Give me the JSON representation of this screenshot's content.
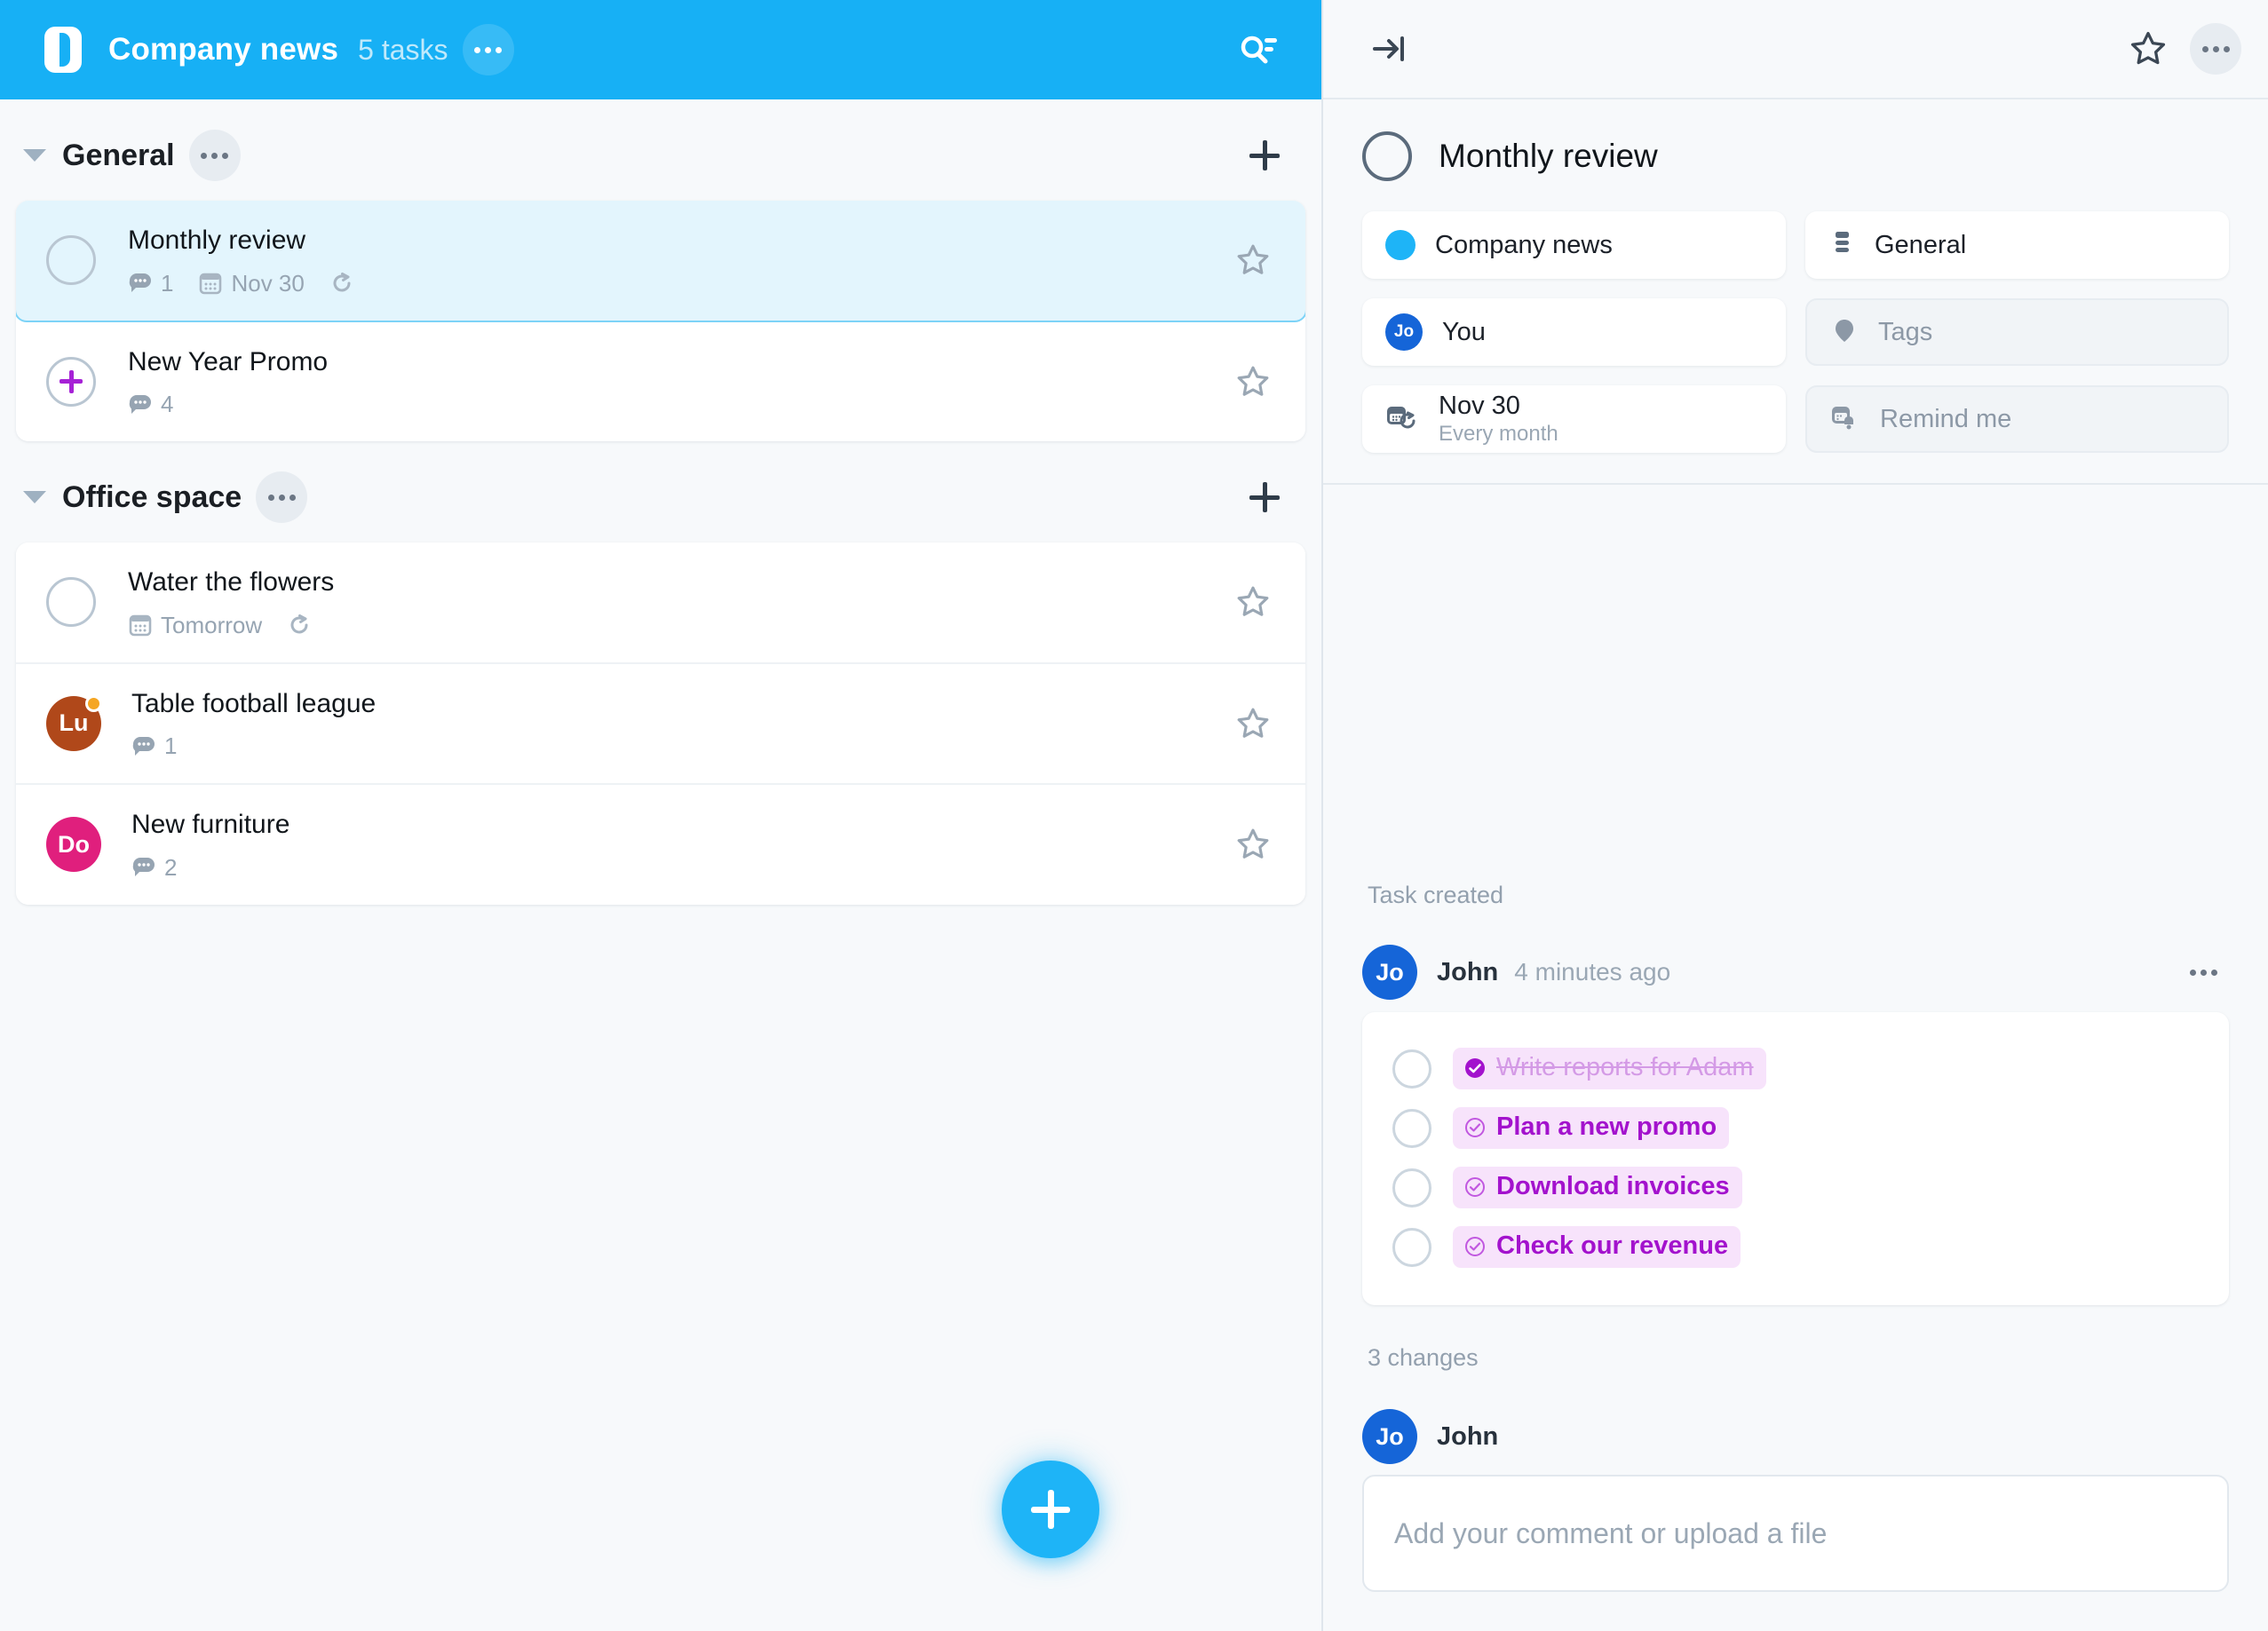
{
  "topbar": {
    "logo_icon": "app-logo-icon",
    "title": "Company news",
    "task_count": "5 tasks",
    "menu_icon": "more-options-icon",
    "search_icon": "search-filter-icon",
    "background_color": "#17b0f5"
  },
  "groups": [
    {
      "name": "General",
      "menu_icon": "more-options-icon",
      "add_icon": "plus-icon",
      "tasks": [
        {
          "title": "Monthly review",
          "selected": true,
          "marker": "checkbox",
          "comment_count": "1",
          "due": "Nov 30",
          "recurring": true,
          "star_icon": "star-outline-icon"
        },
        {
          "title": "New Year Promo",
          "selected": false,
          "marker": "add-subtask",
          "comment_count": "4",
          "due": "",
          "recurring": false,
          "star_icon": "star-outline-icon"
        }
      ]
    },
    {
      "name": "Office space",
      "menu_icon": "more-options-icon",
      "add_icon": "plus-icon",
      "tasks": [
        {
          "title": "Water the flowers",
          "selected": false,
          "marker": "checkbox",
          "comment_count": "",
          "due": "Tomorrow",
          "recurring": true,
          "star_icon": "star-outline-icon"
        },
        {
          "title": "Table football league",
          "selected": false,
          "marker": "avatar",
          "avatar_initials": "Lu",
          "avatar_color": "#b0481a",
          "status_dot_color": "#f5a623",
          "comment_count": "1",
          "due": "",
          "recurring": false,
          "star_icon": "star-outline-icon"
        },
        {
          "title": "New furniture",
          "selected": false,
          "marker": "avatar",
          "avatar_initials": "Do",
          "avatar_color": "#e01f7d",
          "status_dot_color": "",
          "comment_count": "2",
          "due": "",
          "recurring": false,
          "star_icon": "star-outline-icon"
        }
      ]
    }
  ],
  "fab": {
    "icon": "plus-icon",
    "color": "#1eb4f7"
  },
  "detail": {
    "collapse_icon": "collapse-panel-icon",
    "star_icon": "star-outline-icon",
    "menu_icon": "more-options-icon",
    "task_title": "Monthly review",
    "properties": {
      "project": {
        "label": "Company news",
        "icon": "project-dot-icon",
        "color": "#1eb4f7",
        "filled": true
      },
      "section": {
        "label": "General",
        "icon": "section-list-icon",
        "filled": true
      },
      "assignee": {
        "label": "You",
        "icon": "user-avatar-icon",
        "initials": "Jo",
        "filled": true
      },
      "tags": {
        "label": "Tags",
        "icon": "tag-icon",
        "filled": false
      },
      "due_date": {
        "label": "Nov 30",
        "sub_label": "Every month",
        "icon": "calendar-repeat-icon",
        "filled": true
      },
      "reminder": {
        "label": "Remind me",
        "icon": "reminder-bell-icon",
        "filled": false
      }
    },
    "activity": {
      "created_label": "Task created",
      "comment": {
        "avatar_initials": "Jo",
        "author": "John",
        "time": "4 minutes ago",
        "menu_icon": "more-options-icon",
        "checklist": [
          {
            "text": "Write reports for Adam",
            "done": true
          },
          {
            "text": "Plan a new promo",
            "done": false
          },
          {
            "text": "Download invoices",
            "done": false
          },
          {
            "text": "Check our revenue",
            "done": false
          }
        ]
      },
      "changes_label": "3 changes"
    },
    "composer": {
      "avatar_initials": "Jo",
      "author": "John",
      "placeholder": "Add your comment or upload a file"
    }
  }
}
